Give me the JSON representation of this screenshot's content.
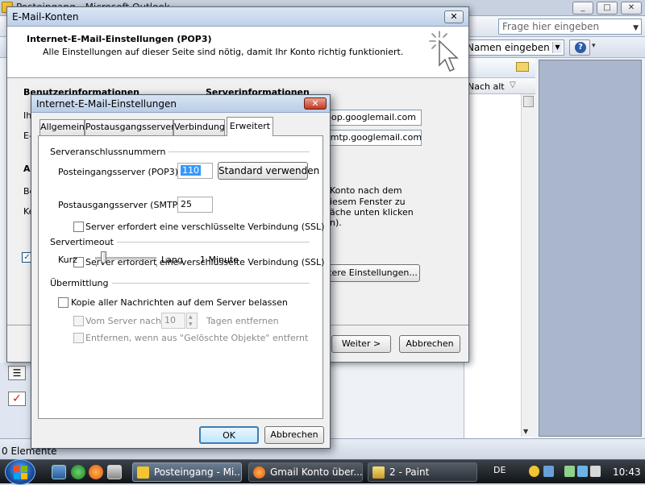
{
  "outlook": {
    "window_title": "Posteingang - Microsoft Outlook",
    "ask_placeholder": "Frage hier eingeben",
    "name_box": "Namen eingeben",
    "help_label": "?",
    "list_header": "Nach alt",
    "status": "0 Elemente",
    "window_buttons": [
      "_",
      "□",
      "✕"
    ]
  },
  "konten": {
    "title": "E-Mail-Konten",
    "close_label": "✕",
    "heading": "Internet-E-Mail-Einstellungen (POP3)",
    "subheading": "Alle Einstellungen auf dieser Seite sind nötig, damit Ihr Konto richtig funktioniert.",
    "section_user": "Benutzerinformationen",
    "section_server": "Serverinformationen",
    "label_ihr": "Ih",
    "label_e": "E-",
    "label_an": "An",
    "label_be": "Be",
    "label_ke": "Ke",
    "incoming_server": "pop.googlemail.com",
    "outgoing_server": "smtp.googlemail.com",
    "hint_lines": [
      "Konto nach dem",
      "iesem Fenster zu",
      "äche unten klicken",
      "n)."
    ],
    "more_settings": "itere Einstellungen...",
    "next": "Weiter >",
    "cancel": "Abbrechen",
    "checkbox_mark": "✓"
  },
  "einstellungen": {
    "title": "Internet-E-Mail-Einstellungen",
    "close_label": "✕",
    "tabs": [
      {
        "label": "Allgemein"
      },
      {
        "label": "Postausgangsserver"
      },
      {
        "label": "Verbindung"
      },
      {
        "label": "Erweitert"
      }
    ],
    "group_ports": "Serveranschlussnummern",
    "pop3_label": "Posteingangsserver (POP3):",
    "pop3_value": "110",
    "default_button": "Standard verwenden",
    "ssl_in_label": "Server erfordert eine verschlüsselte Verbindung (SSL)",
    "smtp_label": "Postausgangsserver (SMTP):",
    "smtp_value": "25",
    "ssl_out_label": "Server erfordert eine verschlüsselte Verbindung (SSL)",
    "group_timeout": "Servertimeout",
    "timeout_short": "Kurz",
    "timeout_long": "Lang",
    "timeout_value": "1 Minute",
    "timeout_level": 0.1,
    "group_delivery": "Übermittlung",
    "keep_copy_label": "Kopie aller Nachrichten auf dem Server belassen",
    "remove_after_label": "Vom Server nach",
    "remove_after_days": "10",
    "days_suffix": "Tagen entfernen",
    "remove_deleted_label": "Entfernen, wenn aus \"Gelöschte Objekte\" entfernt",
    "ok": "OK",
    "cancel": "Abbrechen"
  },
  "taskbar": {
    "tasks": [
      {
        "label": "Posteingang - Mi..."
      },
      {
        "label": "Gmail Konto über..."
      },
      {
        "label": "2 - Paint"
      }
    ],
    "language": "DE",
    "clock": "10:43"
  },
  "colors": {
    "selection": "#3399ff",
    "taskbar": "#1a1f25",
    "reading_pane": "#a9b6cc"
  }
}
